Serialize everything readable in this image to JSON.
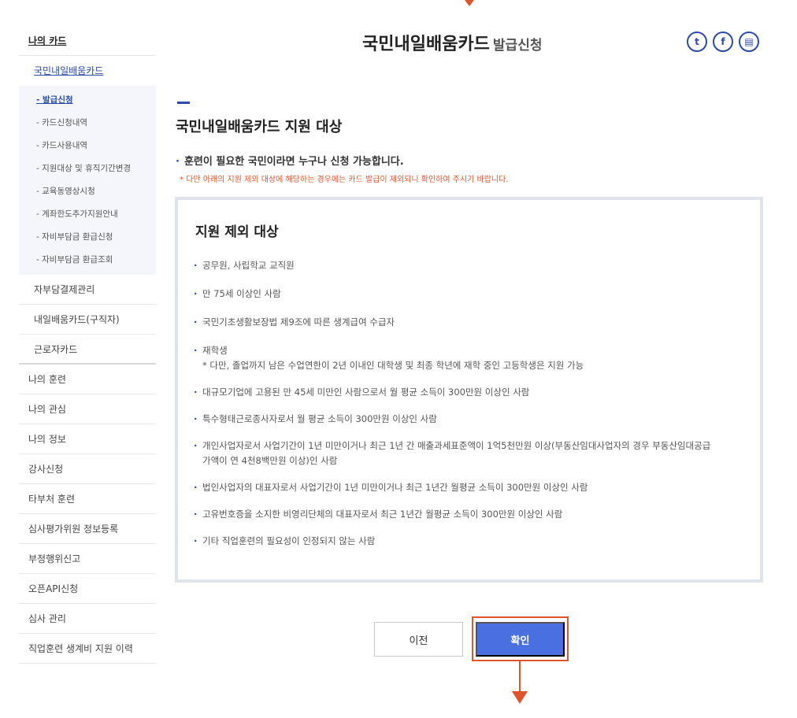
{
  "sidebar": {
    "title": "나의 카드",
    "current": "국민내일배움카드",
    "sub_items": [
      "- 발급신청",
      "- 카드신청내역",
      "- 카드사용내역",
      "- 지원대상 및 휴직기간변경",
      "- 교육동영상시청",
      "- 계좌한도추가지원안내",
      "- 자비부담금 환급신청",
      "- 자비부담금 환급조회"
    ],
    "level2": [
      "자부담결제관리",
      "내일배움카드(구직자)",
      "근로자카드"
    ],
    "menu": [
      "나의 훈련",
      "나의 관심",
      "나의 정보",
      "강사신청",
      "타부처 훈련",
      "심사평가위원 정보등록",
      "부정행위신고",
      "오픈API신청",
      "심사 관리",
      "직업훈련 생계비 지원 이력"
    ]
  },
  "header": {
    "title": "국민내일배움카드",
    "subtitle": "발급신청",
    "share_icons": [
      "twitter-icon",
      "facebook-icon",
      "print-icon"
    ],
    "share_glyphs": [
      "t",
      "f",
      "▤"
    ]
  },
  "content": {
    "section_title": "국민내일배움카드 지원 대상",
    "bullet": "·",
    "lead": "훈련이 필요한 국민이라면 누구나 신청 가능합니다.",
    "note": "* 다만 아래의 지원 제외 대상에 해당하는 경우에는 카드 발급이 제외되니 확인하여 주시기 바랍니다.",
    "box_title": "지원 제외 대상",
    "items": [
      [
        "공무원, 사립학교 교직원"
      ],
      [
        "만 75세 이상인 사람"
      ],
      [
        "국민기초생활보장법 제9조에 따른 생계급여 수급자"
      ],
      [
        "재학생",
        "* 다만, 졸업까지 남은 수업연한이 2년 이내인 대학생 및 최종 학년에 재학 중인 고등학생은 지원 가능"
      ],
      [
        "대규모기업에 고용된 만 45세 미만인 사람으로서 월 평균 소득이 300만원 이상인 사람"
      ],
      [
        "특수형태근로종사자로서 월 평균 소득이 300만원 이상인 사람"
      ],
      [
        "개인사업자로서 사업기간이 1년 미만이거나 최근 1년 간 매출과세표준액이 1억5천만원 이상(부동산임대사업자의 경우 부동산임대공급",
        "가액이 연 4천8백만원 이상)인 사람"
      ],
      [
        "법인사업자의 대표자로서 사업기간이 1년 미만이거나 최근 1년간 월평균 소득이 300만원 이상인 사람"
      ],
      [
        "고유번호증을 소지한 비영리단체의 대표자로서 최근 1년간 월평균 소득이 300만원 이상인 사람"
      ],
      [
        "기타 직업훈련의 필요성이 인정되지 않는 사람"
      ]
    ]
  },
  "buttons": {
    "prev": "이전",
    "confirm": "확인"
  },
  "colors": {
    "accent": "#2c4aa6",
    "confirm_bg": "#4a6fe0",
    "highlight": "#e0542c"
  }
}
